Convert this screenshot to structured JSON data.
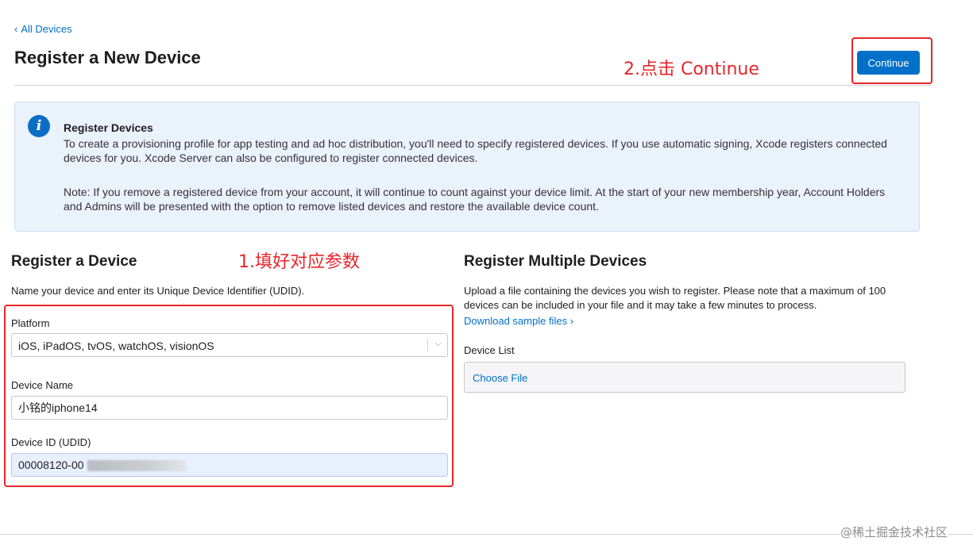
{
  "nav": {
    "back_label": "All Devices"
  },
  "header": {
    "title": "Register a New Device",
    "continue_label": "Continue"
  },
  "annotations": {
    "step2": "2.点击 Continue",
    "step1": "1.填好对应参数"
  },
  "info": {
    "title": "Register Devices",
    "body": "To create a provisioning profile for app testing and ad hoc distribution, you'll need to specify registered devices. If you use automatic signing, Xcode registers connected devices for you. Xcode Server can also be configured to register connected devices.",
    "note": "Note: If you remove a registered device from your account, it will continue to count against your device limit. At the start of your new membership year, Account Holders and Admins will be presented with the option to remove listed devices and restore the available device count."
  },
  "single": {
    "title": "Register a Device",
    "description": "Name your device and enter its Unique Device Identifier (UDID).",
    "platform_label": "Platform",
    "platform_value": "iOS, iPadOS, tvOS, watchOS, visionOS",
    "name_label": "Device Name",
    "name_value": "小铭的iphone14",
    "udid_label": "Device ID (UDID)",
    "udid_value": "00008120-00"
  },
  "multi": {
    "title": "Register Multiple Devices",
    "description": "Upload a file containing the devices you wish to register. Please note that a maximum of 100 devices can be included in your file and it may take a few minutes to process.",
    "sample_link": "Download sample files ›",
    "device_list_label": "Device List",
    "choose_file_label": "Choose File"
  },
  "watermark": "@稀土掘金技术社区",
  "colors": {
    "accent": "#0070c9",
    "annotation": "#e8262b",
    "info_background": "#eaf2fb"
  }
}
